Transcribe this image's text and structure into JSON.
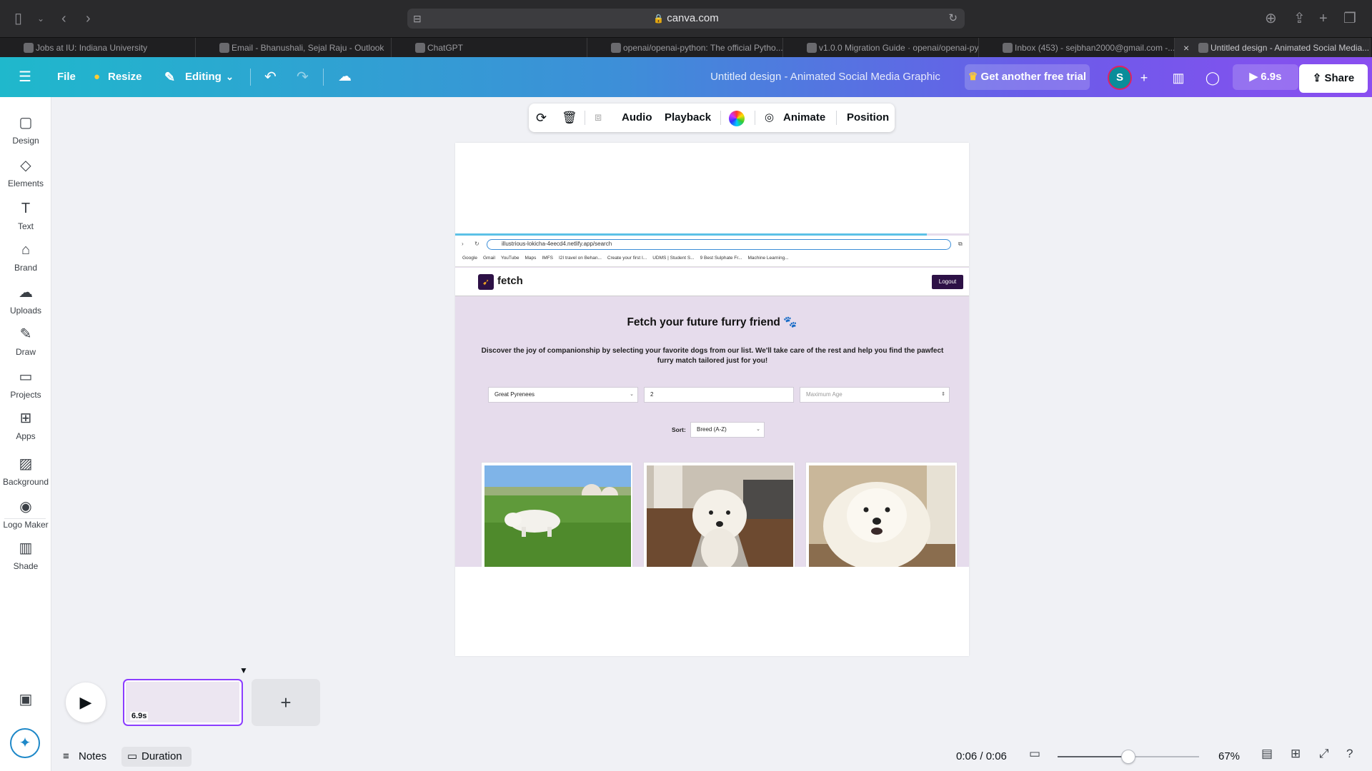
{
  "browser": {
    "url": "canva.com",
    "tabs": [
      {
        "label": "Jobs at IU: Indiana University",
        "active": false
      },
      {
        "label": "Email - Bhanushali, Sejal Raju - Outlook",
        "active": false
      },
      {
        "label": "ChatGPT",
        "active": false
      },
      {
        "label": "openai/openai-python: The official Pytho...",
        "active": false
      },
      {
        "label": "v1.0.0 Migration Guide · openai/openai-py...",
        "active": false
      },
      {
        "label": "Inbox (453) - sejbhan2000@gmail.com -...",
        "active": false
      },
      {
        "label": "Untitled design - Animated Social Media...",
        "active": true
      }
    ]
  },
  "header": {
    "file": "File",
    "resize": "Resize",
    "editing": "Editing",
    "title": "Untitled design - Animated Social Media Graphic",
    "trial": "Get another free trial",
    "avatar": "S",
    "play_time": "6.9s",
    "share": "Share"
  },
  "rail": [
    {
      "label": "Design",
      "icon": "design-icon",
      "glyph": "▢"
    },
    {
      "label": "Elements",
      "icon": "elements-icon",
      "glyph": "◇"
    },
    {
      "label": "Text",
      "icon": "text-icon",
      "glyph": "T"
    },
    {
      "label": "Brand",
      "icon": "brand-icon",
      "glyph": "⌂"
    },
    {
      "label": "Uploads",
      "icon": "uploads-icon",
      "glyph": "☁"
    },
    {
      "label": "Draw",
      "icon": "draw-icon",
      "glyph": "✎"
    },
    {
      "label": "Projects",
      "icon": "projects-icon",
      "glyph": "▭"
    },
    {
      "label": "Apps",
      "icon": "apps-icon",
      "glyph": "⊞"
    },
    {
      "label": "Background",
      "icon": "background-icon",
      "glyph": "▨"
    },
    {
      "label": "Logo Maker",
      "icon": "logo-maker-icon",
      "glyph": "◉"
    },
    {
      "label": "Shade",
      "icon": "shade-icon",
      "glyph": "▥"
    }
  ],
  "toolbar": {
    "audio": "Audio",
    "playback": "Playback",
    "animate": "Animate",
    "position": "Position"
  },
  "design": {
    "url": "illustrious-lokicha-4eecd4.netlify.app/search",
    "bookmarks": [
      "Google",
      "Gmail",
      "YouTube",
      "Maps",
      "IMFS",
      "I2I travel on Behan...",
      "Create your first I...",
      "UDMS | Student S...",
      "9 Best Sulphate Fr...",
      "Machine Learning..."
    ],
    "brand": "fetch",
    "logout": "Logout",
    "heading": "Fetch your future furry friend",
    "paragraph": "Discover the joy of companionship by selecting your favorite dogs from our list. We'll take care of the rest and help you find the pawfect furry match tailored just for you!",
    "breed_value": "Great Pyrenees",
    "min_age_value": "2",
    "max_age_placeholder": "Maximum Age",
    "sort_label": "Sort:",
    "sort_value": "Breed (A-Z)"
  },
  "timeline": {
    "thumb_duration": "6.9s",
    "notes": "Notes",
    "duration": "Duration",
    "time": "0:06 / 0:06",
    "zoom": "67%",
    "zoom_level": 0.5
  }
}
